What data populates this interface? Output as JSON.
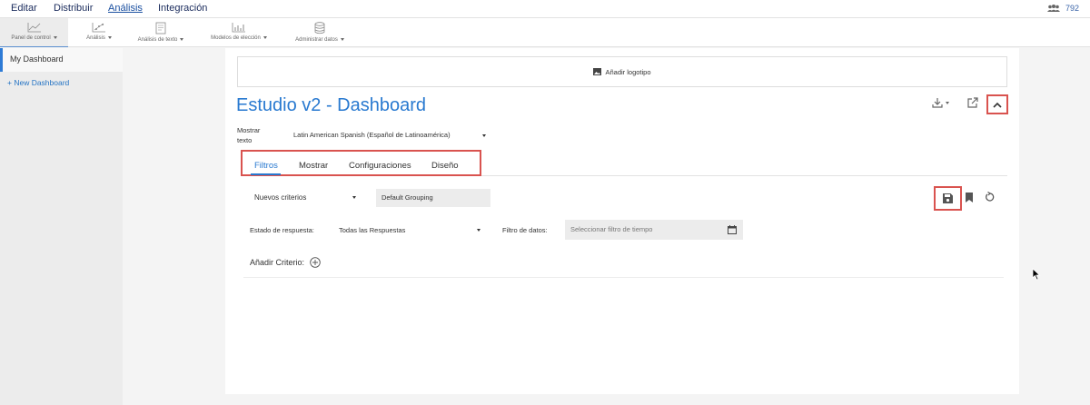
{
  "topnav": {
    "items": [
      "Editar",
      "Distribuir",
      "Análisis",
      "Integración"
    ],
    "user_count": "792"
  },
  "toolbar": {
    "items": [
      {
        "label": "Panel de control",
        "icon": "line-chart-icon"
      },
      {
        "label": "Análisis",
        "icon": "scatter-chart-icon"
      },
      {
        "label": "Análisis de texto",
        "icon": "text-analysis-icon"
      },
      {
        "label": "Modelos de elección",
        "icon": "bar-chart-icon"
      },
      {
        "label": "Administrar datos",
        "icon": "database-icon"
      }
    ]
  },
  "sidebar": {
    "items": [
      "My Dashboard"
    ],
    "new_dashboard": "+ New Dashboard"
  },
  "main": {
    "add_logo": "Añadir logotipo",
    "title": "Estudio v2 - Dashboard",
    "show_text_label": "Mostrar\ntexto",
    "language": "Latin American Spanish (Español de Latinoamérica)",
    "tabs": [
      "Filtros",
      "Mostrar",
      "Configuraciones",
      "Diseño"
    ],
    "criteria_select": "Nuevos criterios",
    "grouping": "Default Grouping",
    "response_label": "Estado de respuesta:",
    "response_value": "Todas las Respuestas",
    "data_filter_label": "Filtro de datos:",
    "data_filter_placeholder": "Seleccionar filtro de tiempo",
    "add_criteria": "Añadir Criterio:"
  },
  "colors": {
    "accent": "#2879d0",
    "highlight": "#d9534f",
    "nav": "#1a2b5c"
  }
}
